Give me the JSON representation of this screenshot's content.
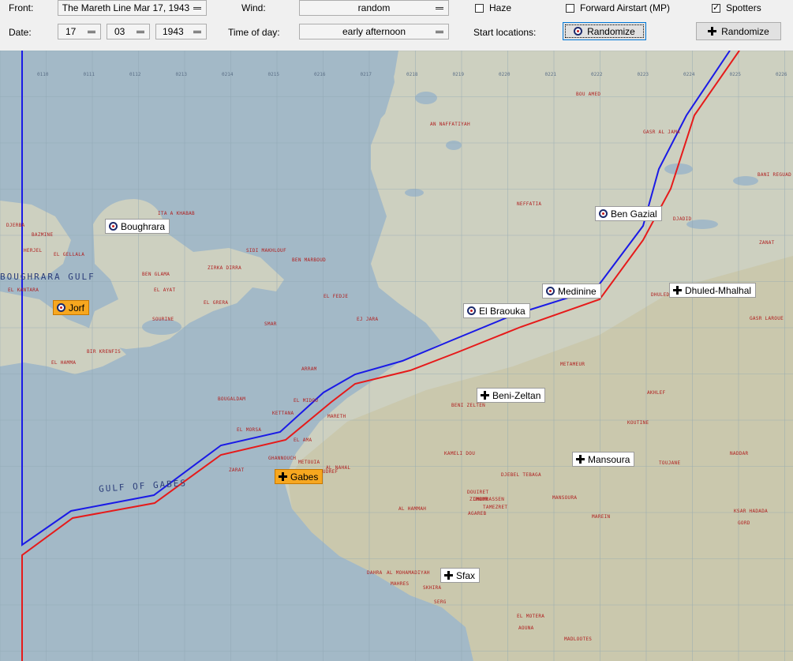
{
  "toolbar": {
    "front_label": "Front:",
    "front_value": "The Mareth Line Mar 17, 1943",
    "date_label": "Date:",
    "day": "17",
    "month": "03",
    "year": "1943",
    "wind_label": "Wind:",
    "wind_value": "random",
    "time_label": "Time of day:",
    "time_value": "early afternoon",
    "haze_label": "Haze",
    "haze_checked": false,
    "forward_label": "Forward Airstart (MP)",
    "forward_checked": false,
    "spotters_label": "Spotters",
    "spotters_checked": true,
    "start_label": "Start locations:",
    "randomize_allied": "Randomize",
    "randomize_axis": "Randomize"
  },
  "map": {
    "colors": {
      "sea": "#a3b9c7",
      "land": "#cdd0c0",
      "front_allied": "#1a1ae6",
      "front_axis": "#e61a1a",
      "airfield_selected": "#f7a71f"
    },
    "sea_names": [
      "GULF OF GABES",
      "BOUGHRARA GULF"
    ],
    "airfields": [
      {
        "name": "Boughrara",
        "side": "allied",
        "selected": false
      },
      {
        "name": "Jorf",
        "side": "allied",
        "selected": true
      },
      {
        "name": "Ben Gazial",
        "side": "allied",
        "selected": false
      },
      {
        "name": "Medinine",
        "side": "allied",
        "selected": false
      },
      {
        "name": "El Braouka",
        "side": "allied",
        "selected": false
      },
      {
        "name": "Dhuled-Mhalhal",
        "side": "axis",
        "selected": false
      },
      {
        "name": "Beni-Zeltan",
        "side": "axis",
        "selected": false
      },
      {
        "name": "Mansoura",
        "side": "axis",
        "selected": false
      },
      {
        "name": "Gabes",
        "side": "axis",
        "selected": true
      },
      {
        "name": "Sfax",
        "side": "axis",
        "selected": false
      }
    ],
    "places": [
      "BOU AMED",
      "AN NAFFATIYAH",
      "GASR AL JAMA",
      "BANI REGUAD",
      "NEFFATIA",
      "DJADID",
      "ZANAT",
      "ITA A KHABAB",
      "DJERBA",
      "BAZMINE",
      "HERJEL",
      "EL GELLALA",
      "EL KANTARA",
      "SIDI MAKHLOUF",
      "BEN MARBOUD",
      "ZIRKA DIRRA",
      "BEN GLAMA",
      "EL AYAT",
      "EL GRERA",
      "SOURINE",
      "EL FEDJE",
      "SMAR",
      "EJ JARA",
      "BIR KRENFIS",
      "EL HAMMA",
      "EL MIDOU",
      "ARRAM",
      "BOUGALDAM",
      "EL MORSA",
      "METAMEUR",
      "DHULED",
      "GASR LAROUE",
      "AKHLEF",
      "KOUTINE",
      "BENI ZELTEN",
      "KAMELI DOU",
      "DJEBEL TEBAGA",
      "MANSOURA",
      "TOUJANE",
      "NADDAR",
      "DOUIRET",
      "ZIMOUR",
      "AL HAMMAH",
      "MAREIN",
      "KSAR HADADA",
      "GHOMRASSEN",
      "AL MOHAMADIYAH",
      "MAHRES",
      "AGAREB",
      "DAHRA",
      "SKHIRA",
      "EL MOTERA",
      "SERG",
      "MADLOOTES",
      "AOUNA",
      "GORD",
      "TAMEZRET",
      "GHANNOUCH",
      "METOUIA",
      "OUDREF",
      "AL NAHAL",
      "ZARAT",
      "KETTANA",
      "MARETH",
      "EL AMA"
    ],
    "grid_labels": [
      "0110",
      "0111",
      "0112",
      "0213",
      "0214",
      "0215",
      "0216",
      "0217",
      "0218",
      "0219",
      "0220",
      "0221",
      "0222",
      "0223",
      "0224",
      "0225",
      "0226"
    ]
  }
}
